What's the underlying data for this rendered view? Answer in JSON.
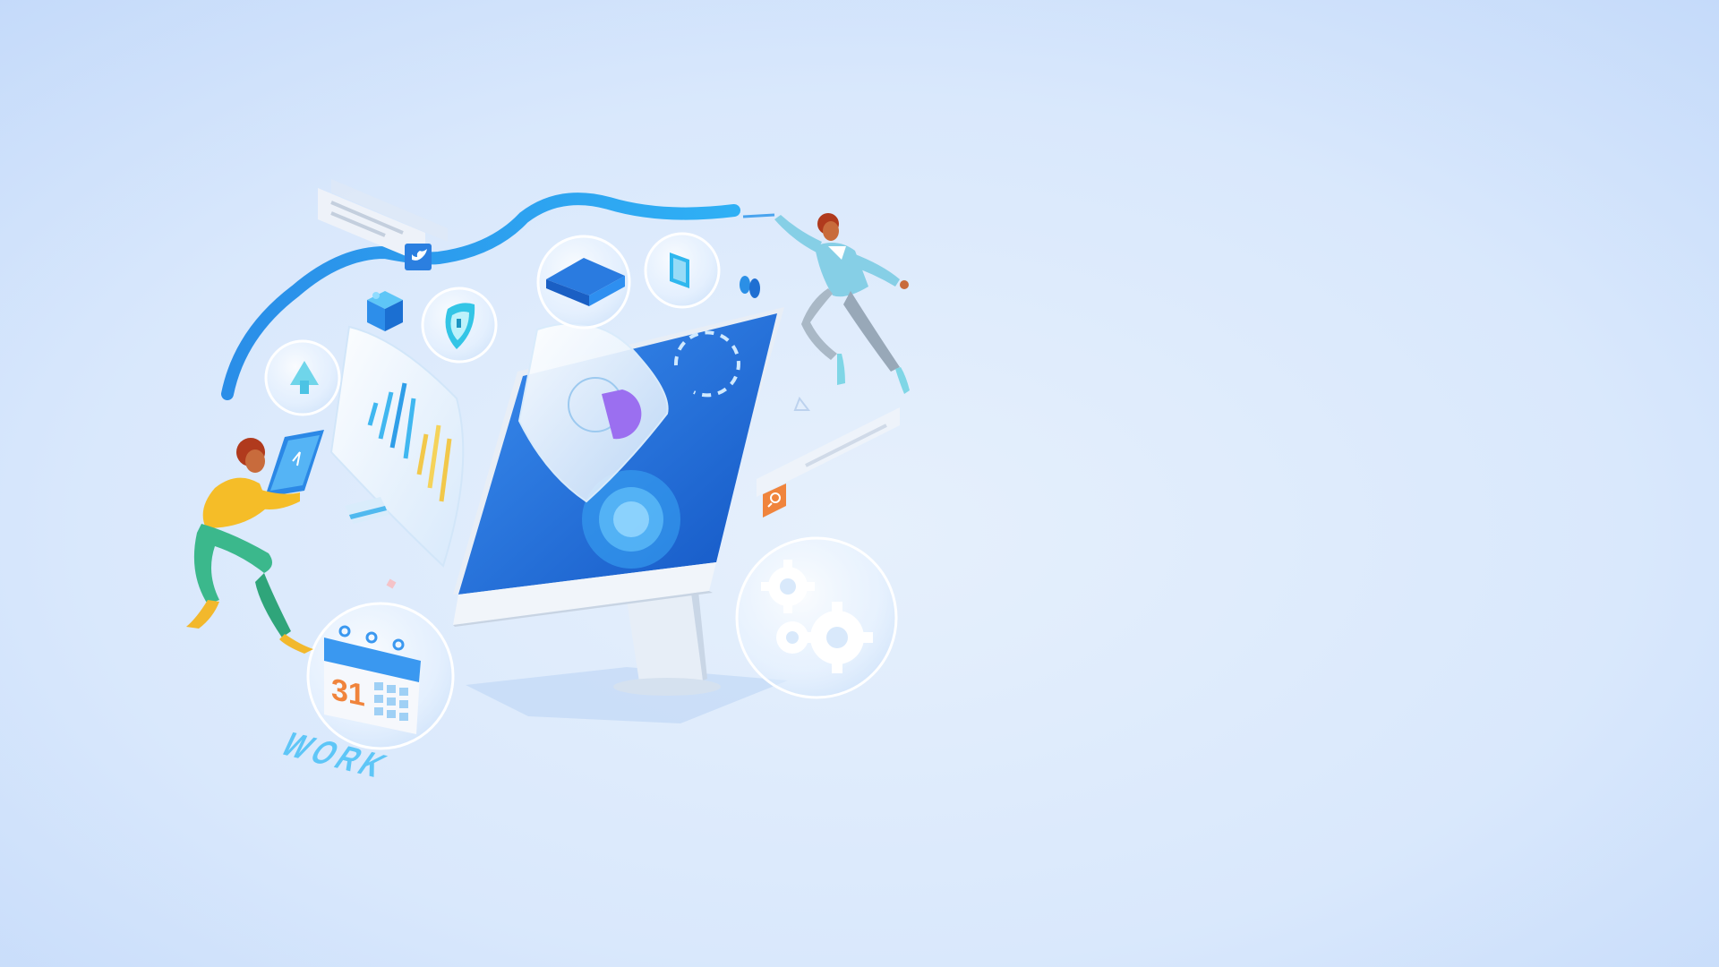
{
  "colors": {
    "background_light": "#e4effc",
    "background_edge": "#c6dcfb",
    "brand_blue": "#1e6fdc",
    "ribbon_blue": "#2b9df0",
    "screen_blue": "#1f6ee0",
    "accent_orange": "#f0843c",
    "accent_yellow": "#f5c12e",
    "accent_green": "#3fb58a",
    "accent_teal": "#8fd3ec"
  },
  "illustration": {
    "calendar_day": "31",
    "floor_word": "WORK"
  },
  "icons": [
    "twitter-bird-icon",
    "cloud-upload-icon",
    "shield-icon",
    "mail-icon",
    "phone-icon",
    "butterfly-icon",
    "search-icon",
    "gear-icon",
    "calendar-icon",
    "bar-chart-icon",
    "pie-chart-icon",
    "tablet-icon",
    "cube-icon",
    "credit-card-icon"
  ]
}
